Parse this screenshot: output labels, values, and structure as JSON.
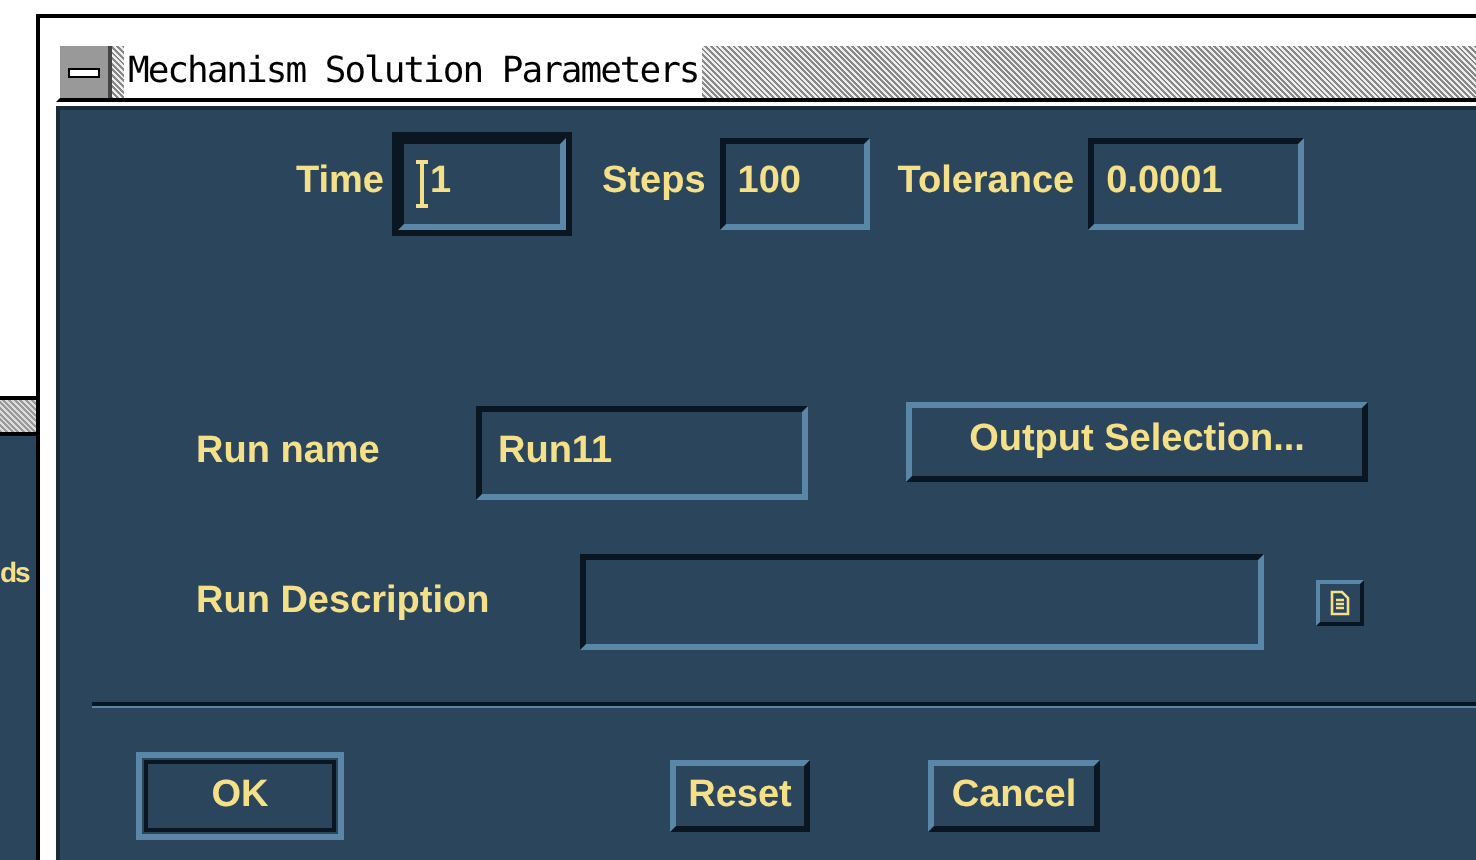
{
  "background_window": {
    "text": "ds"
  },
  "window": {
    "title": "Mechanism Solution Parameters"
  },
  "top_fields": [
    {
      "label": "Time",
      "value": "1",
      "focused": true
    },
    {
      "label": "Steps",
      "value": "100",
      "focused": false
    },
    {
      "label": "Tolerance",
      "value": "0.0001",
      "focused": false
    }
  ],
  "run_name": {
    "label": "Run name",
    "value": "Run11"
  },
  "output_button": "Output Selection...",
  "run_description": {
    "label": "Run Description"
  },
  "buttons": [
    {
      "label": "OK",
      "default": true
    },
    {
      "label": "Reset",
      "default": false
    },
    {
      "label": "Cancel",
      "default": false
    }
  ]
}
